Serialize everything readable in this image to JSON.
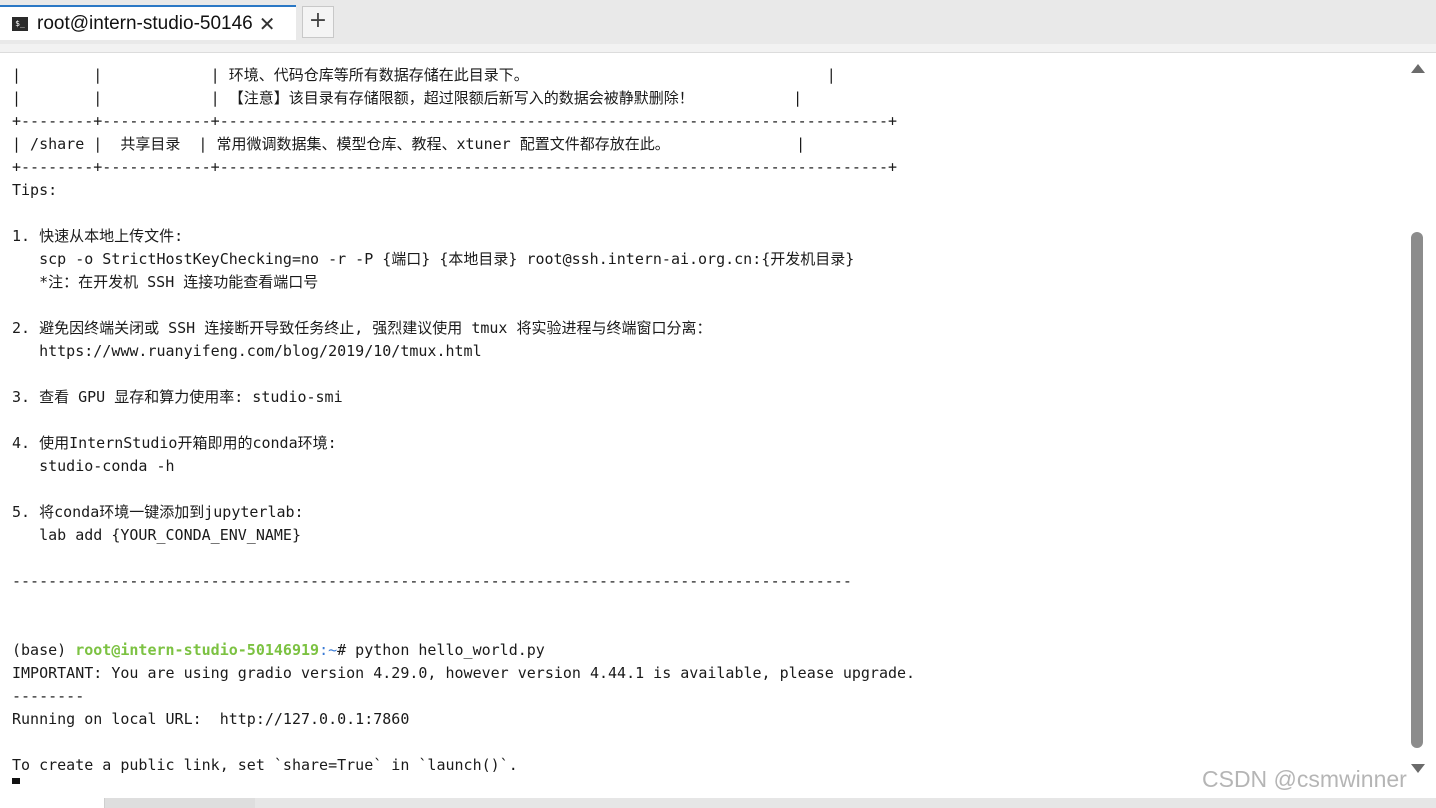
{
  "tab": {
    "icon_glyph": "$_",
    "title": "root@intern-studio-50146",
    "close_glyph": "✕",
    "add_glyph": "+"
  },
  "terminal": {
    "lines": [
      "|        |            | 环境、代码仓库等所有数据存储在此目录下。                                 |",
      "|        |            | 【注意】该目录有存储限额，超过限额后新写入的数据会被静默删除！           |",
      "+--------+------------+--------------------------------------------------------------------------+",
      "| /share |  共享目录  | 常用微调数据集、模型仓库、教程、xtuner 配置文件都存放在此。              |",
      "+--------+------------+--------------------------------------------------------------------------+",
      "Tips:",
      "",
      "1. 快速从本地上传文件:",
      "   scp -o StrictHostKeyChecking=no -r -P {端口} {本地目录} root@ssh.intern-ai.org.cn:{开发机目录}",
      "   *注：在开发机 SSH 连接功能查看端口号",
      "",
      "2. 避免因终端关闭或 SSH 连接断开导致任务终止, 强烈建议使用 tmux 将实验进程与终端窗口分离：",
      "   https://www.ruanyifeng.com/blog/2019/10/tmux.html",
      "",
      "3. 查看 GPU 显存和算力使用率: studio-smi",
      "",
      "4. 使用InternStudio开箱即用的conda环境:",
      "   studio-conda -h",
      "",
      "5. 将conda环境一键添加到jupyterlab:",
      "   lab add {YOUR_CONDA_ENV_NAME}",
      "",
      "---------------------------------------------------------------------------------------------",
      "",
      ""
    ],
    "prompt": {
      "env": "(base) ",
      "user": "root@intern-studio-50146919",
      "path": ":~",
      "command": "# python hello_world.py"
    },
    "output_lines": [
      "IMPORTANT: You are using gradio version 4.29.0, however version 4.44.1 is available, please upgrade.",
      "--------",
      "Running on local URL:  http://127.0.0.1:7860",
      "",
      "To create a public link, set `share=True` in `launch()`."
    ]
  },
  "watermark": "CSDN @csmwinner"
}
